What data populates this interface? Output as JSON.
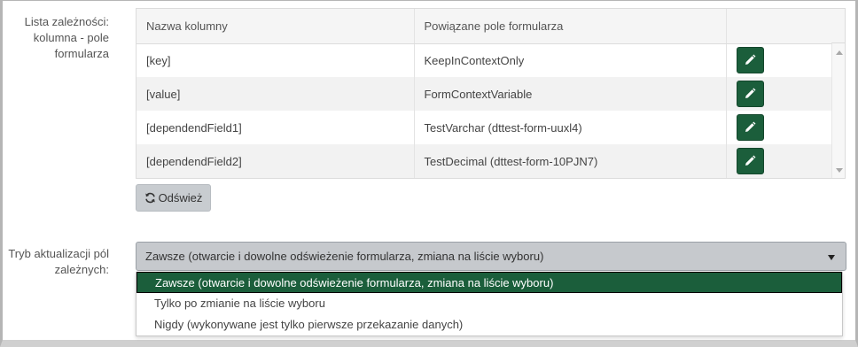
{
  "labels": {
    "dependencies": "Lista zależności: kolumna - pole formularza",
    "update_mode": "Tryb aktualizacji pól zależnych:"
  },
  "table": {
    "headers": [
      "Nazwa kolumny",
      "Powiązane pole formularza",
      ""
    ],
    "rows": [
      {
        "column": "[key]",
        "field": "KeepInContextOnly"
      },
      {
        "column": "[value]",
        "field": "FormContextVariable"
      },
      {
        "column": "[dependendField1]",
        "field": "TestVarchar (dttest-form-uuxl4)"
      },
      {
        "column": "[dependendField2]",
        "field": "TestDecimal (dttest-form-10PJN7)"
      }
    ]
  },
  "refresh_button": {
    "label": "Odśwież",
    "icon": "refresh-icon"
  },
  "update_mode_select": {
    "selected": "Zawsze (otwarcie i dowolne odświeżenie formularza, zmiana na liście wyboru)",
    "options": [
      "Zawsze (otwarcie i dowolne odświeżenie formularza, zmiana na liście wyboru)",
      "Tylko po zmianie na liście wyboru",
      "Nigdy (wykonywane jest tylko pierwsze przekazanie danych)"
    ]
  },
  "colors": {
    "accent": "#1b5e3b",
    "select_bg": "#c6c9cd",
    "button_bg": "#c8ccd0"
  }
}
